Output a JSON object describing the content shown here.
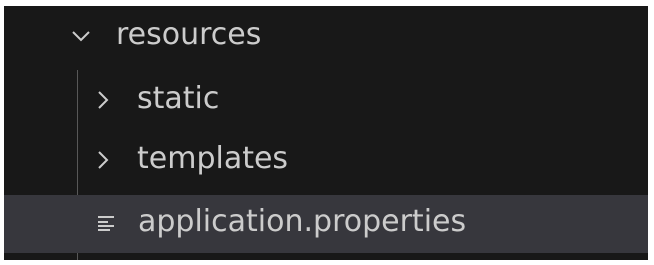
{
  "explorer": {
    "items": [
      {
        "label": "resources",
        "icon": "chevron-down-icon"
      },
      {
        "label": "static",
        "icon": "chevron-right-icon"
      },
      {
        "label": "templates",
        "icon": "chevron-right-icon"
      },
      {
        "label": "application.properties",
        "icon": "lines-file-icon"
      }
    ]
  },
  "colors": {
    "background": "#181818",
    "selected_row": "#37373d",
    "text": "#cccccc",
    "indent_guide": "#585858"
  }
}
